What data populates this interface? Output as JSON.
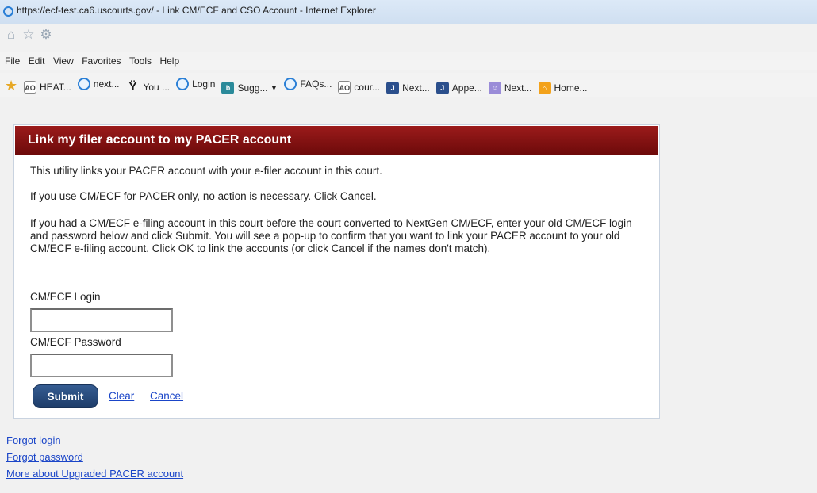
{
  "window": {
    "title": "https://ecf-test.ca6.uscourts.gov/ - Link CM/ECF and CSO Account - Internet Explorer",
    "toolbar_icons": [
      {
        "name": "home-icon",
        "glyph": "⌂"
      },
      {
        "name": "star-icon",
        "glyph": "☆"
      },
      {
        "name": "gear-icon",
        "glyph": "⚙"
      }
    ]
  },
  "menu": [
    "File",
    "Edit",
    "View",
    "Favorites",
    "Tools",
    "Help"
  ],
  "favorites": [
    {
      "label": "HEAT...",
      "icon": "ao",
      "glyph": "AO"
    },
    {
      "label": "next...",
      "icon": "ie",
      "glyph": ""
    },
    {
      "label": "You ...",
      "icon": "y",
      "glyph": "Ÿ"
    },
    {
      "label": "Login",
      "icon": "ie",
      "glyph": ""
    },
    {
      "label": "Sugg...",
      "icon": "b",
      "glyph": "b",
      "dropdown": true
    },
    {
      "label": "FAQs...",
      "icon": "ie",
      "glyph": ""
    },
    {
      "label": "cour...",
      "icon": "ao",
      "glyph": "AO"
    },
    {
      "label": "Next...",
      "icon": "j",
      "glyph": "J"
    },
    {
      "label": "Appe...",
      "icon": "j",
      "glyph": "J"
    },
    {
      "label": "Next...",
      "icon": "face",
      "glyph": "☺"
    },
    {
      "label": "Home...",
      "icon": "home",
      "glyph": "⌂"
    }
  ],
  "panel": {
    "title": "Link my filer account to my PACER account",
    "para1": "This utility links your PACER account with your e-filer account in this court.",
    "para2": "If you use CM/ECF for PACER only, no action is necessary. Click Cancel.",
    "para3": "If you had a CM/ECF e-filing account in this court before the court converted to NextGen CM/ECF, enter your old CM/ECF login and password below and click Submit. You will see a pop-up to confirm that you want to link your PACER account to your old CM/ECF e-filing account. Click OK to link the accounts (or click Cancel if the names don't match).",
    "login_label": "CM/ECF Login",
    "login_value": "",
    "password_label": "CM/ECF Password",
    "password_value": "",
    "submit_label": "Submit",
    "clear_label": "Clear",
    "cancel_label": "Cancel"
  },
  "links": {
    "forgot_login": "Forgot login",
    "forgot_password": "Forgot password",
    "more": "More about Upgraded PACER account"
  },
  "colors": {
    "header_red": "#7f1010",
    "button_blue": "#2a4f82",
    "link_blue": "#1a45c8"
  }
}
